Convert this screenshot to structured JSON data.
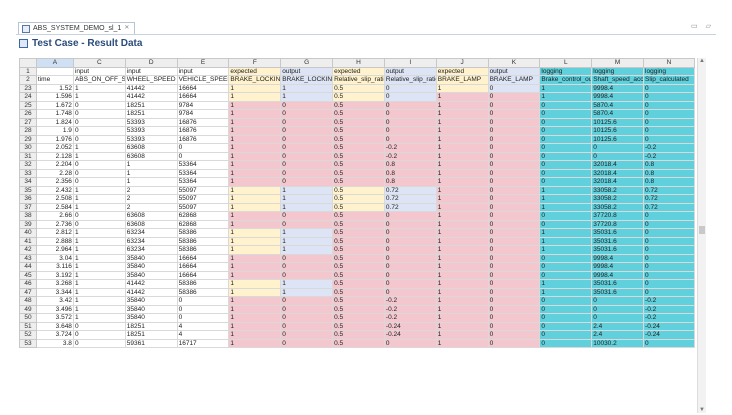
{
  "editor_tab": {
    "label": "ABS_SYSTEM_DEMO_sl_1",
    "close_glyph": "✕"
  },
  "window_controls": "▭ ▱",
  "section": {
    "title": "Test Case - Result Data"
  },
  "column_letters": [
    "A",
    "C",
    "D",
    "E",
    "F",
    "G",
    "H",
    "I",
    "J",
    "K",
    "L",
    "M",
    "N"
  ],
  "header_row1": {
    "row": "1",
    "cells": [
      "",
      "input",
      "input",
      "input",
      "expected",
      "output",
      "expected",
      "output",
      "expected",
      "output",
      "logging",
      "logging",
      "logging"
    ]
  },
  "header_row2": {
    "row": "2",
    "cells": [
      "time",
      "ABS_ON_OFF_SW",
      "WHEEL_SPEED",
      "VEHICLE_SPEED",
      "BRAKE_LOCKING",
      "BRAKE_LOCKING",
      "Relative_slip_ratio",
      "Relative_slip_ratio",
      "BRAKE_LAMP",
      "BRAKE_LAMP",
      "Brake_control_out",
      "Shaft_speed_accel",
      "Slip_calculated"
    ]
  },
  "colors": {
    "input": "#ffffff",
    "expected": "#fff2cc",
    "output": "#dde4f5",
    "logging": "#5fd0dc",
    "failed_cell": "#f4c7ce"
  },
  "rows": [
    {
      "n": "23",
      "cells": [
        "1.52",
        "1",
        "41442",
        "16664",
        "1",
        "1",
        "0.5",
        "0",
        "1",
        "0",
        "1",
        "9998.4",
        "0"
      ],
      "fail": []
    },
    {
      "n": "24",
      "cells": [
        "1.596",
        "1",
        "41442",
        "16664",
        "1",
        "1",
        "0.5",
        "0",
        "1",
        "0",
        "1",
        "9998.4",
        "0"
      ],
      "fail": [
        8,
        9
      ]
    },
    {
      "n": "25",
      "cells": [
        "1.672",
        "0",
        "18251",
        "9784",
        "1",
        "0",
        "0.5",
        "0",
        "1",
        "0",
        "0",
        "5870.4",
        "0"
      ],
      "fail": [
        4,
        5,
        6,
        7,
        8,
        9
      ]
    },
    {
      "n": "26",
      "cells": [
        "1.748",
        "0",
        "18251",
        "9784",
        "1",
        "0",
        "0.5",
        "0",
        "1",
        "0",
        "0",
        "5870.4",
        "0"
      ],
      "fail": [
        4,
        5,
        6,
        7,
        8,
        9
      ]
    },
    {
      "n": "27",
      "cells": [
        "1.824",
        "0",
        "53393",
        "16876",
        "1",
        "0",
        "0.5",
        "0",
        "1",
        "0",
        "0",
        "10125.6",
        "0"
      ],
      "fail": [
        4,
        5,
        6,
        7,
        8,
        9
      ]
    },
    {
      "n": "28",
      "cells": [
        "1.9",
        "0",
        "53393",
        "16876",
        "1",
        "0",
        "0.5",
        "0",
        "1",
        "0",
        "0",
        "10125.6",
        "0"
      ],
      "fail": [
        4,
        5,
        6,
        7,
        8,
        9
      ]
    },
    {
      "n": "29",
      "cells": [
        "1.976",
        "0",
        "53393",
        "16876",
        "1",
        "0",
        "0.5",
        "0",
        "1",
        "0",
        "0",
        "10125.6",
        "0"
      ],
      "fail": [
        4,
        5,
        6,
        7,
        8,
        9
      ]
    },
    {
      "n": "30",
      "cells": [
        "2.052",
        "1",
        "63608",
        "0",
        "1",
        "0",
        "0.5",
        "-0.2",
        "1",
        "0",
        "0",
        "0",
        "-0.2"
      ],
      "fail": [
        4,
        5,
        6,
        7,
        8,
        9
      ]
    },
    {
      "n": "31",
      "cells": [
        "2.128",
        "1",
        "63608",
        "0",
        "1",
        "0",
        "0.5",
        "-0.2",
        "1",
        "0",
        "0",
        "0",
        "-0.2"
      ],
      "fail": [
        4,
        5,
        6,
        7,
        8,
        9
      ]
    },
    {
      "n": "32",
      "cells": [
        "2.204",
        "0",
        "1",
        "53364",
        "1",
        "0",
        "0.5",
        "0.8",
        "1",
        "0",
        "0",
        "32018.4",
        "0.8"
      ],
      "fail": [
        4,
        5,
        6,
        7,
        8,
        9
      ]
    },
    {
      "n": "33",
      "cells": [
        "2.28",
        "0",
        "1",
        "53364",
        "1",
        "0",
        "0.5",
        "0.8",
        "1",
        "0",
        "0",
        "32018.4",
        "0.8"
      ],
      "fail": [
        4,
        5,
        6,
        7,
        8,
        9
      ]
    },
    {
      "n": "34",
      "cells": [
        "2.356",
        "0",
        "1",
        "53364",
        "1",
        "0",
        "0.5",
        "0.8",
        "1",
        "0",
        "0",
        "32018.4",
        "0.8"
      ],
      "fail": [
        4,
        5,
        6,
        7,
        8,
        9
      ]
    },
    {
      "n": "35",
      "cells": [
        "2.432",
        "1",
        "2",
        "55097",
        "1",
        "1",
        "0.5",
        "0.72",
        "1",
        "0",
        "1",
        "33058.2",
        "0.72"
      ],
      "fail": [
        8,
        9
      ]
    },
    {
      "n": "36",
      "cells": [
        "2.508",
        "1",
        "2",
        "55097",
        "1",
        "1",
        "0.5",
        "0.72",
        "1",
        "0",
        "1",
        "33058.2",
        "0.72"
      ],
      "fail": [
        8,
        9
      ]
    },
    {
      "n": "37",
      "cells": [
        "2.584",
        "1",
        "2",
        "55097",
        "1",
        "1",
        "0.5",
        "0.72",
        "1",
        "0",
        "1",
        "33058.2",
        "0.72"
      ],
      "fail": [
        8,
        9
      ]
    },
    {
      "n": "38",
      "cells": [
        "2.66",
        "0",
        "63608",
        "62868",
        "1",
        "0",
        "0.5",
        "0",
        "1",
        "0",
        "0",
        "37720.8",
        "0"
      ],
      "fail": [
        4,
        5,
        6,
        7,
        8,
        9
      ]
    },
    {
      "n": "39",
      "cells": [
        "2.736",
        "0",
        "63608",
        "62868",
        "1",
        "0",
        "0.5",
        "0",
        "1",
        "0",
        "0",
        "37720.8",
        "0"
      ],
      "fail": [
        4,
        5,
        6,
        7,
        8,
        9
      ]
    },
    {
      "n": "40",
      "cells": [
        "2.812",
        "1",
        "63234",
        "58386",
        "1",
        "1",
        "0.5",
        "0",
        "1",
        "0",
        "1",
        "35031.6",
        "0"
      ],
      "fail": [
        6,
        7,
        8,
        9
      ]
    },
    {
      "n": "41",
      "cells": [
        "2.888",
        "1",
        "63234",
        "58386",
        "1",
        "1",
        "0.5",
        "0",
        "1",
        "0",
        "1",
        "35031.6",
        "0"
      ],
      "fail": [
        6,
        7,
        8,
        9
      ]
    },
    {
      "n": "42",
      "cells": [
        "2.964",
        "1",
        "63234",
        "58386",
        "1",
        "1",
        "0.5",
        "0",
        "1",
        "0",
        "1",
        "35031.6",
        "0"
      ],
      "fail": [
        6,
        7,
        8,
        9
      ]
    },
    {
      "n": "43",
      "cells": [
        "3.04",
        "1",
        "35840",
        "16664",
        "1",
        "0",
        "0.5",
        "0",
        "1",
        "0",
        "0",
        "9998.4",
        "0"
      ],
      "fail": [
        4,
        5,
        6,
        7,
        8,
        9
      ]
    },
    {
      "n": "44",
      "cells": [
        "3.116",
        "1",
        "35840",
        "16664",
        "1",
        "0",
        "0.5",
        "0",
        "1",
        "0",
        "0",
        "9998.4",
        "0"
      ],
      "fail": [
        4,
        5,
        6,
        7,
        8,
        9
      ]
    },
    {
      "n": "45",
      "cells": [
        "3.192",
        "1",
        "35840",
        "16664",
        "1",
        "0",
        "0.5",
        "0",
        "1",
        "0",
        "0",
        "9998.4",
        "0"
      ],
      "fail": [
        4,
        5,
        6,
        7,
        8,
        9
      ]
    },
    {
      "n": "46",
      "cells": [
        "3.268",
        "1",
        "41442",
        "58386",
        "1",
        "1",
        "0.5",
        "0",
        "1",
        "0",
        "1",
        "35031.6",
        "0"
      ],
      "fail": [
        6,
        7,
        8,
        9
      ]
    },
    {
      "n": "47",
      "cells": [
        "3.344",
        "1",
        "41442",
        "58386",
        "1",
        "1",
        "0.5",
        "0",
        "1",
        "0",
        "1",
        "35031.6",
        "0"
      ],
      "fail": [
        6,
        7,
        8,
        9
      ]
    },
    {
      "n": "48",
      "cells": [
        "3.42",
        "1",
        "35840",
        "0",
        "1",
        "0",
        "0.5",
        "-0.2",
        "1",
        "0",
        "0",
        "0",
        "-0.2"
      ],
      "fail": [
        4,
        5,
        6,
        7,
        8,
        9
      ]
    },
    {
      "n": "49",
      "cells": [
        "3.496",
        "1",
        "35840",
        "0",
        "1",
        "0",
        "0.5",
        "-0.2",
        "1",
        "0",
        "0",
        "0",
        "-0.2"
      ],
      "fail": [
        4,
        5,
        6,
        7,
        8,
        9
      ]
    },
    {
      "n": "50",
      "cells": [
        "3.572",
        "1",
        "35840",
        "0",
        "1",
        "0",
        "0.5",
        "-0.2",
        "1",
        "0",
        "0",
        "0",
        "-0.2"
      ],
      "fail": [
        4,
        5,
        6,
        7,
        8,
        9
      ]
    },
    {
      "n": "51",
      "cells": [
        "3.648",
        "0",
        "18251",
        "4",
        "1",
        "0",
        "0.5",
        "-0.24",
        "1",
        "0",
        "0",
        "2.4",
        "-0.24"
      ],
      "fail": [
        4,
        5,
        6,
        7,
        8,
        9
      ]
    },
    {
      "n": "52",
      "cells": [
        "3.724",
        "0",
        "18251",
        "4",
        "1",
        "0",
        "0.5",
        "-0.24",
        "1",
        "0",
        "0",
        "2.4",
        "-0.24"
      ],
      "fail": [
        4,
        5,
        6,
        7,
        8,
        9
      ]
    },
    {
      "n": "53",
      "cells": [
        "3.8",
        "0",
        "59361",
        "16717",
        "1",
        "0",
        "0.5",
        "0",
        "1",
        "0",
        "0",
        "10030.2",
        "0"
      ],
      "fail": [
        4,
        5,
        6,
        7,
        8,
        9
      ]
    }
  ]
}
